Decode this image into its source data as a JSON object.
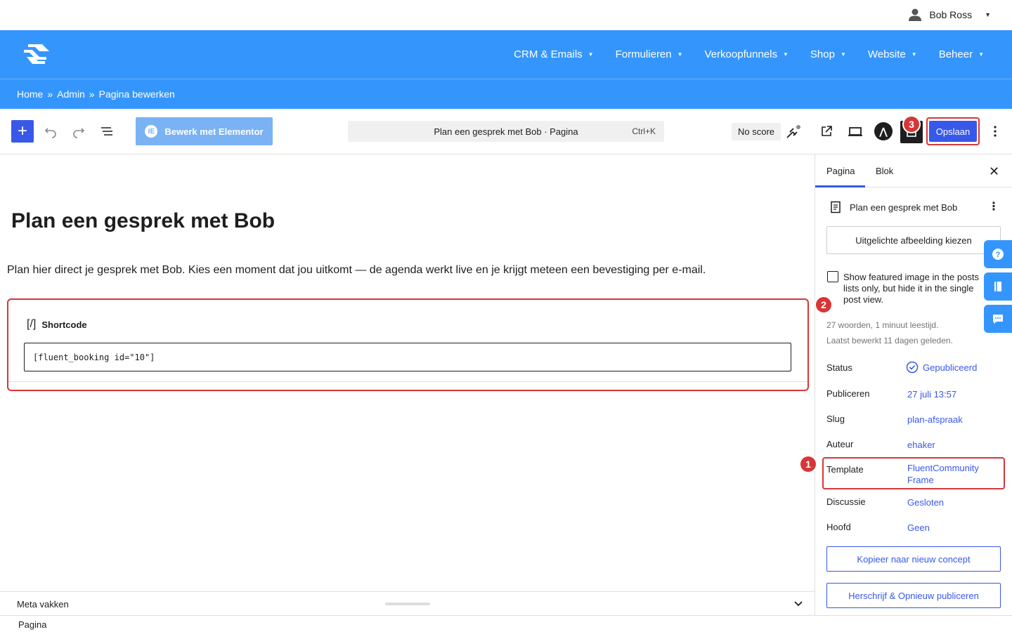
{
  "user": {
    "name": "Bob Ross"
  },
  "nav": {
    "items": [
      {
        "label": "CRM & Emails"
      },
      {
        "label": "Formulieren"
      },
      {
        "label": "Verkoopfunnels"
      },
      {
        "label": "Shop"
      },
      {
        "label": "Website"
      },
      {
        "label": "Beheer"
      }
    ]
  },
  "breadcrumb": {
    "items": [
      "Home",
      "Admin",
      "Pagina bewerken"
    ],
    "separator": "»"
  },
  "toolbar": {
    "elementor_label": "Bewerk met Elementor",
    "command": "Plan een gesprek met Bob · Pagina",
    "command_shortcut": "Ctrl+K",
    "no_score": "No score",
    "save_label": "Opslaan",
    "badge_number": "3"
  },
  "content": {
    "title": "Plan een gesprek met Bob",
    "paragraph": "Plan hier direct je gesprek met Bob. Kies een moment dat jou uitkomt — de agenda werkt live en je krijgt meteen een bevestiging per e-mail.",
    "shortcode_label": "Shortcode",
    "shortcode_icon": "[/]",
    "shortcode_value": "[fluent_booking id=\"10\"]",
    "badge_number": "2"
  },
  "meta": {
    "label": "Meta vakken"
  },
  "footer": {
    "label": "Pagina"
  },
  "sidebar": {
    "tabs": [
      {
        "label": "Pagina"
      },
      {
        "label": "Blok"
      }
    ],
    "doc_title": "Plan een gesprek met Bob",
    "featured_button": "Uitgelichte afbeelding kiezen",
    "featured_checkbox": "Show featured image in the posts lists only, but hide it in the single post view.",
    "stats_words": "27 woorden, 1 minuut leestijd.",
    "stats_edited": "Laatst bewerkt 11 dagen geleden.",
    "rows": [
      {
        "key": "Status",
        "value": "Gepubliceerd"
      },
      {
        "key": "Publiceren",
        "value": "27 juli 13:57"
      },
      {
        "key": "Slug",
        "value": "plan-afspraak"
      },
      {
        "key": "Auteur",
        "value": "ehaker"
      },
      {
        "key": "Template",
        "value": "FluentCommunity Frame"
      },
      {
        "key": "Discussie",
        "value": "Gesloten"
      },
      {
        "key": "Hoofd",
        "value": "Geen"
      }
    ],
    "copy_button": "Kopieer naar nieuw concept",
    "rewrite_button": "Herschrijf & Opnieuw publiceren",
    "badge_number": "1"
  },
  "colors": {
    "brand_blue": "#3496fd",
    "wp_blue": "#3858e9",
    "highlight_red": "#d63638"
  },
  "icons": [
    "user-icon",
    "logo-icon",
    "plus-icon",
    "undo-icon",
    "redo-icon",
    "list-view-icon",
    "elementor-icon",
    "seo-icon",
    "external-link-icon",
    "device-preview-icon",
    "astra-icon",
    "plugin-icon",
    "more-vertical-icon",
    "close-icon",
    "document-icon",
    "check-circle-icon",
    "chevron-down-icon",
    "help-icon",
    "book-icon",
    "chat-icon"
  ]
}
